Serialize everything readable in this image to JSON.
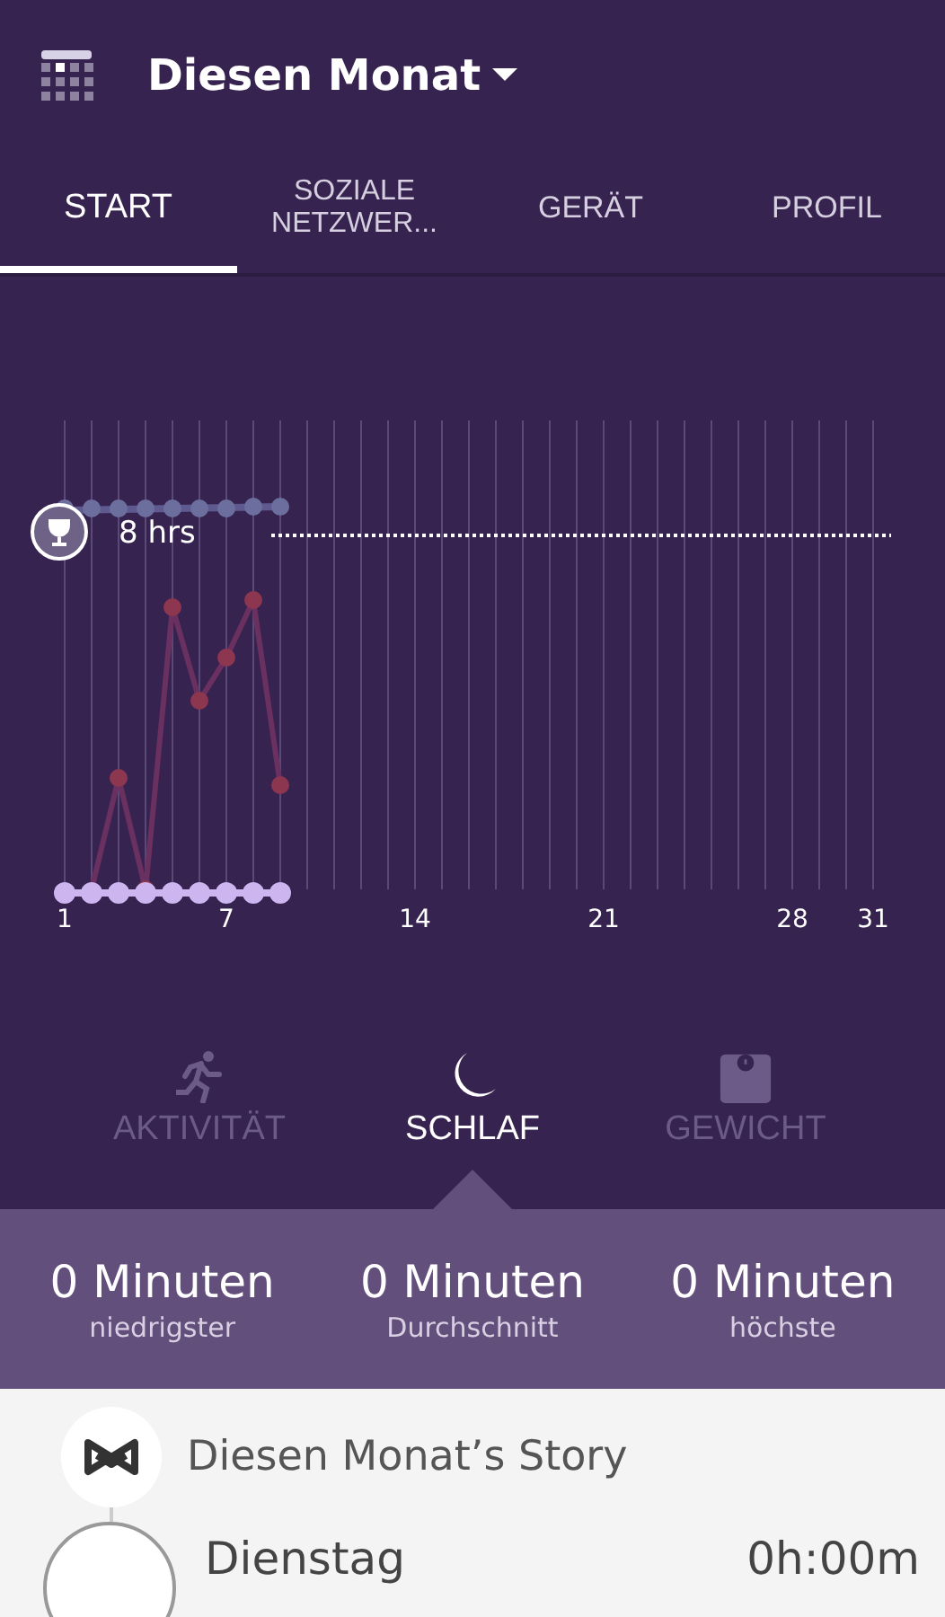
{
  "header": {
    "title": "Diesen Monat"
  },
  "tabs": [
    {
      "label": "START",
      "selected": true
    },
    {
      "label": "SOZIALE NETZWER...",
      "selected": false
    },
    {
      "label": "GERÄT",
      "selected": false
    },
    {
      "label": "PROFIL",
      "selected": false
    }
  ],
  "chart": {
    "goal_label": "8  hrs",
    "x_labels": [
      "1",
      "7",
      "14",
      "21",
      "28",
      "31"
    ]
  },
  "categories": [
    {
      "kind": "activity",
      "label": "AKTIVITÄT",
      "selected": false
    },
    {
      "kind": "sleep",
      "label": "SCHLAF",
      "selected": true
    },
    {
      "kind": "weight",
      "label": "GEWICHT",
      "selected": false
    }
  ],
  "stats": [
    {
      "value": "0 Minuten",
      "label": "niedrigster"
    },
    {
      "value": "0 Minuten",
      "label": "Durchschnitt"
    },
    {
      "value": "0 Minuten",
      "label": "höchste"
    }
  ],
  "story": {
    "title": "Diesen Monat’s Story",
    "entries": [
      {
        "day": "Dienstag",
        "duration": "0h:00m"
      }
    ]
  }
}
